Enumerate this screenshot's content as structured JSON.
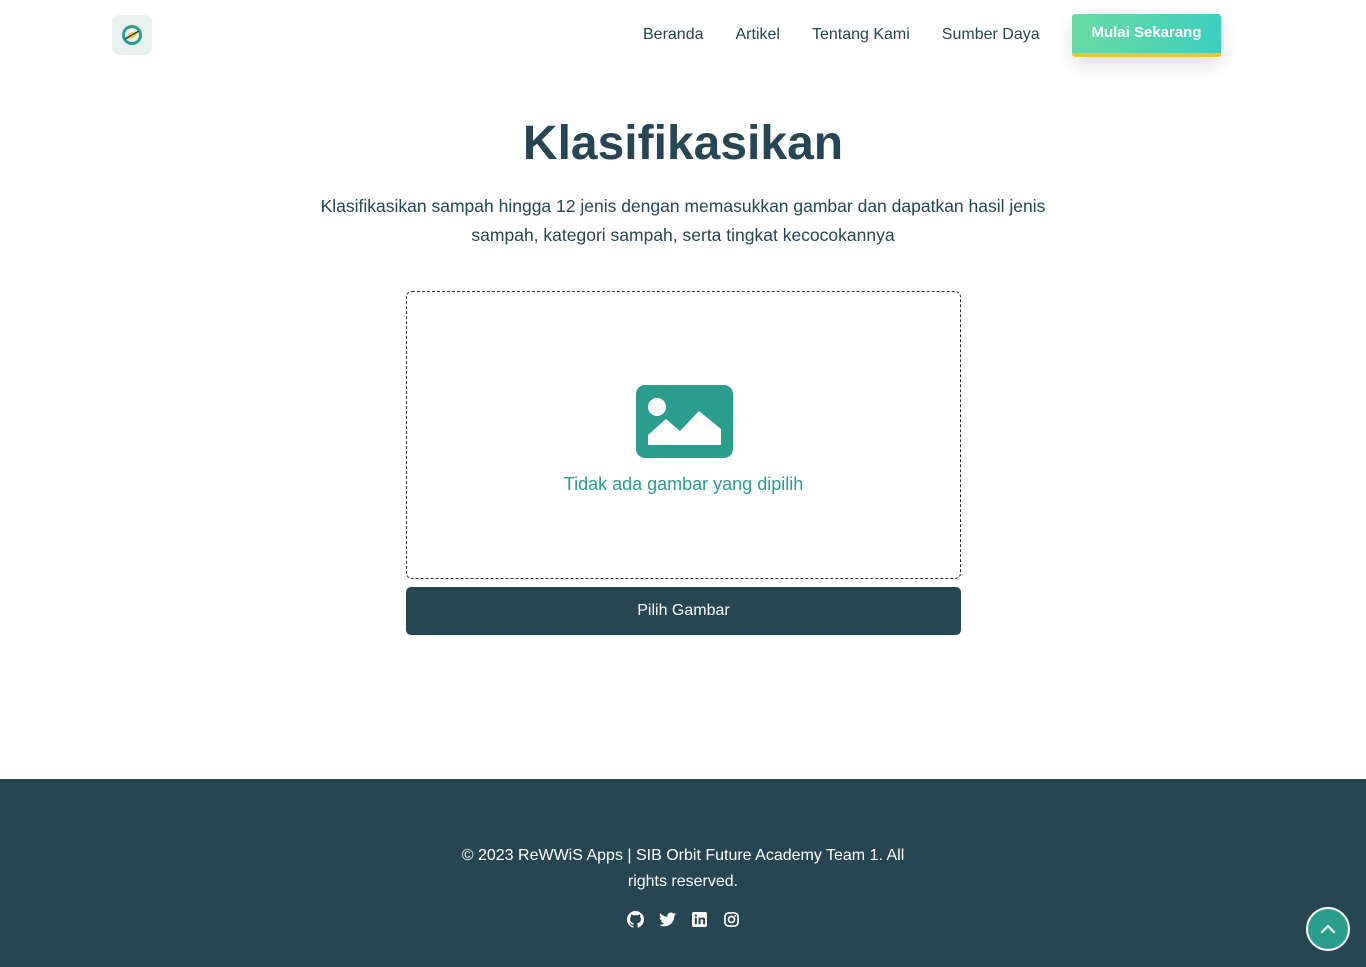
{
  "nav": {
    "logo_icon": "leaf-globe-icon",
    "links": [
      "Beranda",
      "Artikel",
      "Tentang Kami",
      "Sumber Daya"
    ],
    "cta_label": "Mulai Sekarang"
  },
  "main": {
    "title": "Klasifikasikan",
    "description": "Klasifikasikan sampah hingga 12 jenis dengan memasukkan gambar dan dapatkan hasil jenis sampah, kategori sampah, serta tingkat kecocokannya",
    "dropzone": {
      "icon": "image-placeholder-icon",
      "empty_text": "Tidak ada gambar yang dipilih"
    },
    "pick_button_label": "Pilih Gambar"
  },
  "footer": {
    "copyright": "© 2023 ReWWiS Apps | SIB Orbit Future Academy Team 1. All rights reserved.",
    "social_icons": [
      "github-icon",
      "twitter-icon",
      "linkedin-icon",
      "instagram-icon"
    ]
  },
  "scroll_top_icon": "chevron-up-icon",
  "colors": {
    "primary_dark": "#264653",
    "accent_teal": "#2a9d8f",
    "cta_gradient_start": "#69dba1",
    "cta_gradient_end": "#3dcfc0",
    "cta_underline": "#f4c430"
  }
}
